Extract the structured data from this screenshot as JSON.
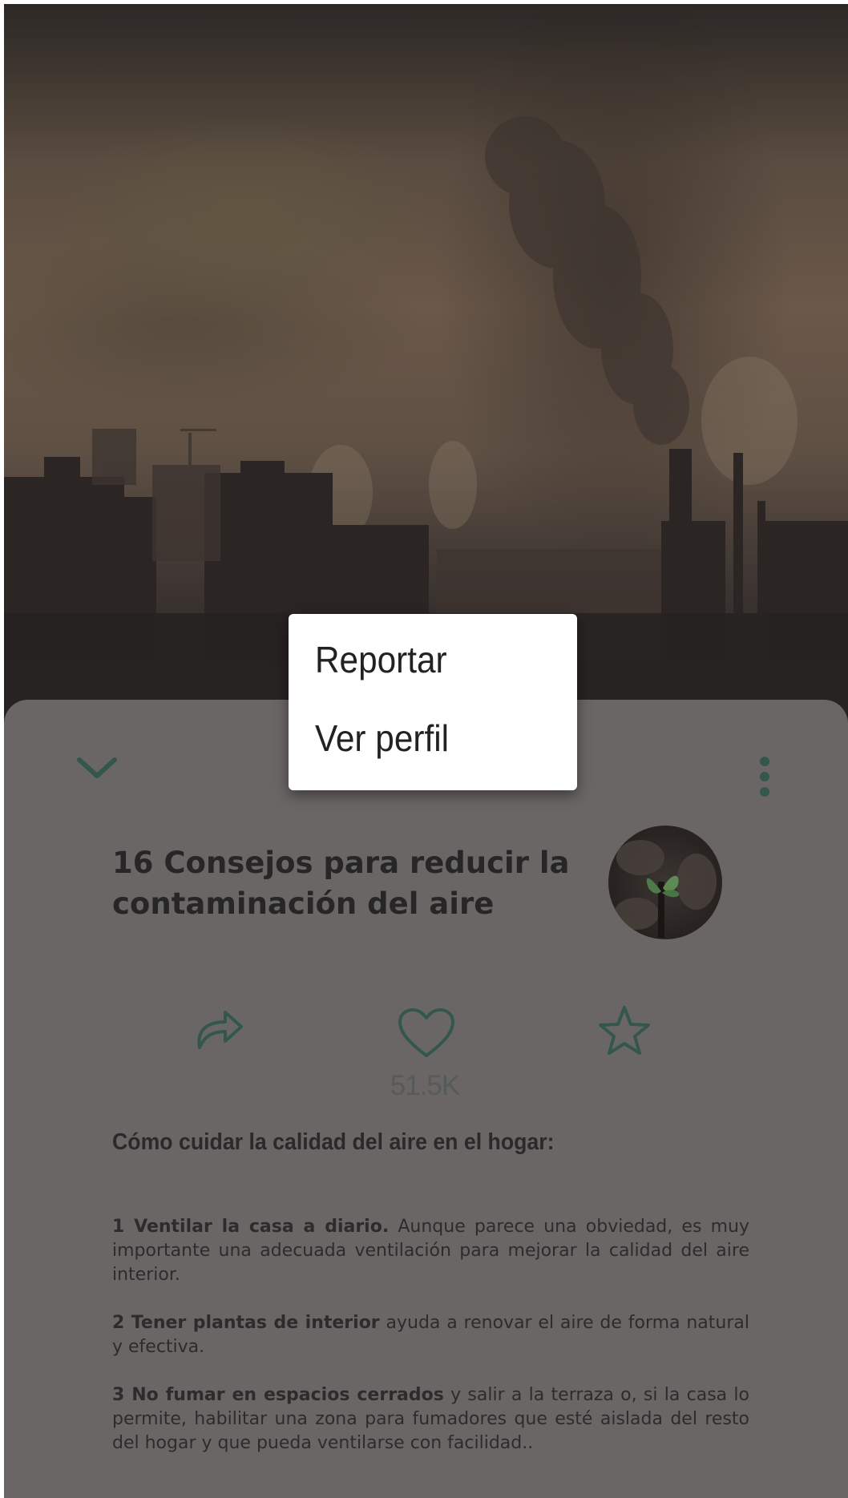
{
  "article": {
    "title": "16 Consejos para reducir la contaminación del aire",
    "likes": "51.5K",
    "section_title": "Cómo cuidar la calidad del aire en el hogar:",
    "tips": [
      {
        "lead": "1 Ventilar la casa a diario.",
        "text": " Aunque parece una obviedad, es muy importante una adecuada ventilación para mejorar la calidad del aire interior."
      },
      {
        "lead": "2 Tener plantas de interior",
        "text": " ayuda a renovar el aire de forma natural y efectiva."
      },
      {
        "lead": "3 No fumar en espacios cerrados",
        "text": " y salir a la terraza o, si la casa lo permite, habilitar una zona para fumadores que esté aislada del resto del hogar y que pueda ventilarse con facilidad.."
      }
    ]
  },
  "menu": {
    "items": [
      {
        "label": "Reportar"
      },
      {
        "label": "Ver perfil"
      }
    ]
  },
  "icons": {
    "collapse": "chevron-down-icon",
    "more": "more-vertical-icon",
    "share": "share-icon",
    "like": "heart-icon",
    "favorite": "star-icon"
  },
  "colors": {
    "accent": "#33574d",
    "scrim": "#6b6666",
    "menu_bg": "#ffffff"
  }
}
